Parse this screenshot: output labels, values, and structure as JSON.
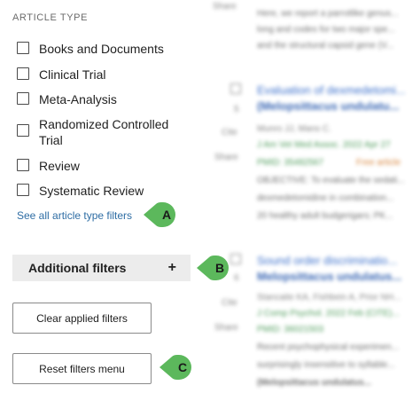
{
  "filters": {
    "section_title": "ARTICLE TYPE",
    "options": [
      {
        "label": "Books and Documents"
      },
      {
        "label": "Clinical Trial"
      },
      {
        "label": "Meta-Analysis"
      },
      {
        "label": "Randomized Controlled Trial"
      },
      {
        "label": "Review"
      },
      {
        "label": "Systematic Review"
      }
    ],
    "see_all": "See all article type filters",
    "additional_filters": "Additional filters",
    "additional_icon": "+",
    "clear_button": "Clear applied filters",
    "reset_button": "Reset filters menu"
  },
  "callouts": [
    "A",
    "B",
    "C"
  ],
  "colors": {
    "callout_green": "#5cb85c",
    "link_blue": "#2e6da4",
    "result_title_blue": "#1f5bc4"
  },
  "results": {
    "actions": [
      "Share",
      "Cite",
      "Share",
      "Cite",
      "Share"
    ],
    "items": [
      {
        "snippet_1": "Here, we report a parrotlike genus...",
        "snippet_2": "long and codes for two major spe...",
        "snippet_3": "and the structural capsid gene (V..."
      },
      {
        "number": "5",
        "title_1": "Evaluation of dexmedetomi...",
        "title_2": "(Melopsittacus undulatu...",
        "authors": "Munro JJ, Mans C.",
        "journal": "J Am Vet Med Assoc. 2022 Apr 27",
        "pmid": "PMID: 35482567",
        "free": "Free article",
        "snippet_1": "OBJECTIVE: To evaluate the sedati...",
        "snippet_2": "dexmedetomidine in combination...",
        "snippet_3": "20 healthy adult budgerigars; PK..."
      },
      {
        "number": "6",
        "title_1": "Sound order discriminatio...",
        "title_2": "Melopsittacus undulatus...",
        "authors": "Stancaite KA, Fishbein A, Prior NH...",
        "journal": "J Comp Psychol. 2022 Feb (CITE)...",
        "pmid": "PMID: 36021503",
        "snippet_1": "Recent psychophysical experimen...",
        "snippet_2": "surprisingly insensitive to syllable...",
        "snippet_3": "(Melopsittacus undulatus..."
      }
    ]
  }
}
